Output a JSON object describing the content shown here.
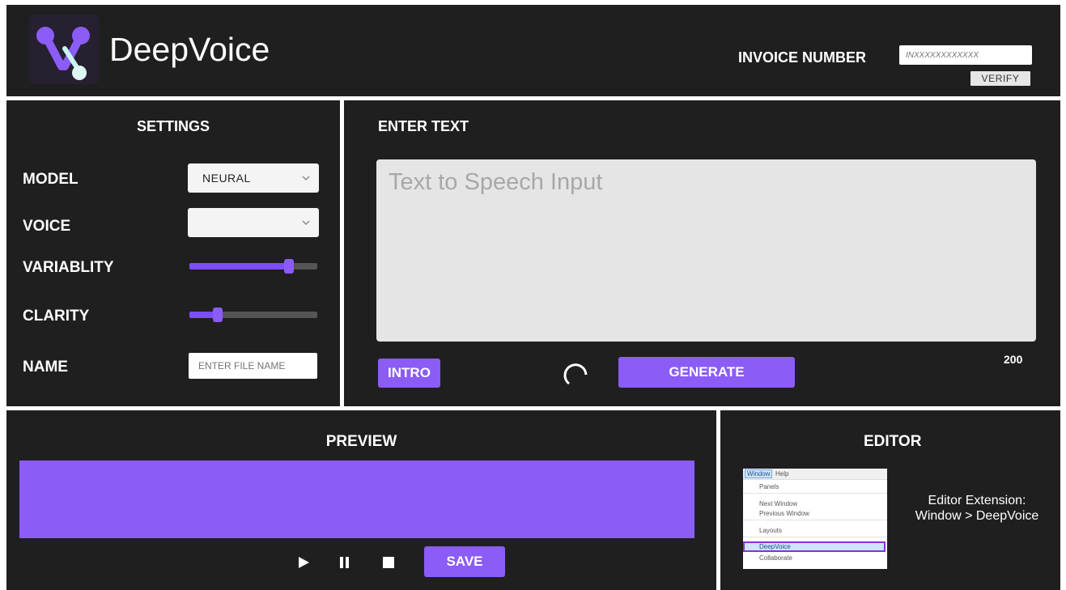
{
  "app": {
    "title": "DeepVoice",
    "brand_color": "#8b5cf6"
  },
  "header": {
    "invoice_label": "INVOICE NUMBER",
    "invoice_placeholder": "INXXXXXXXXXXXX",
    "verify_label": "VERIFY"
  },
  "settings": {
    "title": "SETTINGS",
    "model_label": "MODEL",
    "model_value": "NEURAL",
    "voice_label": "VOICE",
    "voice_value": "",
    "variability_label": "VARIABLITY",
    "variability_value": 0.78,
    "clarity_label": "CLARITY",
    "clarity_value": 0.22,
    "name_label": "NAME",
    "name_placeholder": "ENTER FILE NAME"
  },
  "enter_text": {
    "title": "ENTER TEXT",
    "placeholder": "Text to Speech Input",
    "char_limit": "200",
    "intro_label": "INTRO",
    "generate_label": "GENERATE"
  },
  "preview": {
    "title": "PREVIEW",
    "save_label": "SAVE",
    "icons": [
      "play-icon",
      "pause-icon",
      "stop-icon"
    ]
  },
  "editor": {
    "title": "EDITOR",
    "caption_line1": "Editor Extension:",
    "caption_line2": "Window > DeepVoice",
    "menu": {
      "bar": [
        "Window",
        "Help"
      ],
      "items": [
        "Panels",
        "Next Window",
        "Previous Window",
        "Layouts",
        "DeepVoice",
        "Collaborate"
      ],
      "highlighted": "DeepVoice"
    }
  }
}
